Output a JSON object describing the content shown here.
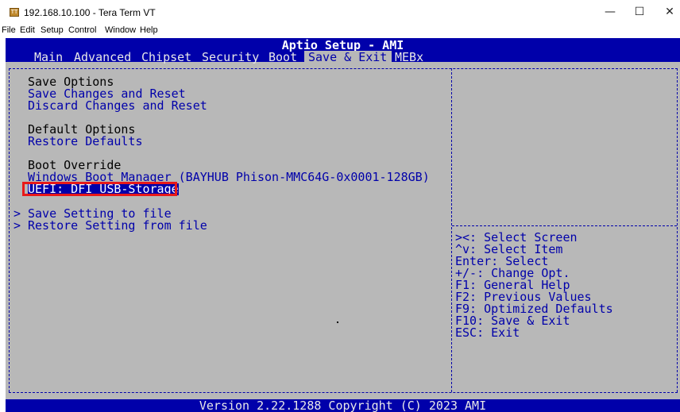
{
  "window": {
    "title": "192.168.10.100 - Tera Term VT",
    "icon_label": "TT",
    "minimize": "—",
    "maximize": "☐",
    "close": "✕"
  },
  "menubar": [
    "File",
    "Edit",
    "Setup",
    "Control",
    "Window",
    "Help"
  ],
  "bios": {
    "title": "Aptio Setup - AMI",
    "tabs": [
      "Main",
      "Advanced",
      "Chipset",
      "Security",
      "Boot",
      "Save & Exit",
      "MEBx"
    ],
    "active_tab": "Save & Exit",
    "left_panel": {
      "save_options_header": "Save Options",
      "save_changes_and_reset": "Save Changes and Reset",
      "discard_changes_and_reset": "Discard Changes and Reset",
      "default_options_header": "Default Options",
      "restore_defaults": "Restore Defaults",
      "boot_override_header": "Boot Override",
      "boot_item_1": "Windows Boot Manager (BAYHUB Phison-MMC64G-0x0001-128GB)",
      "boot_item_2": "UEFI: DFI USB-Storage",
      "save_setting_to_file": "Save Setting to file",
      "restore_setting_from_file": "Restore Setting from file",
      "submenu_marker": ">"
    },
    "help_panel": [
      "><: Select Screen",
      "^v: Select Item",
      "Enter: Select",
      "+/-: Change Opt.",
      "F1: General Help",
      "F2: Previous Values",
      "F9: Optimized Defaults",
      "F10: Save & Exit",
      "ESC: Exit"
    ],
    "footer": "Version 2.22.1288 Copyright (C) 2023 AMI"
  },
  "colors": {
    "bios_blue": "#0000aa",
    "bios_gray": "#b8b8b8",
    "highlight_box": "#e81919"
  }
}
